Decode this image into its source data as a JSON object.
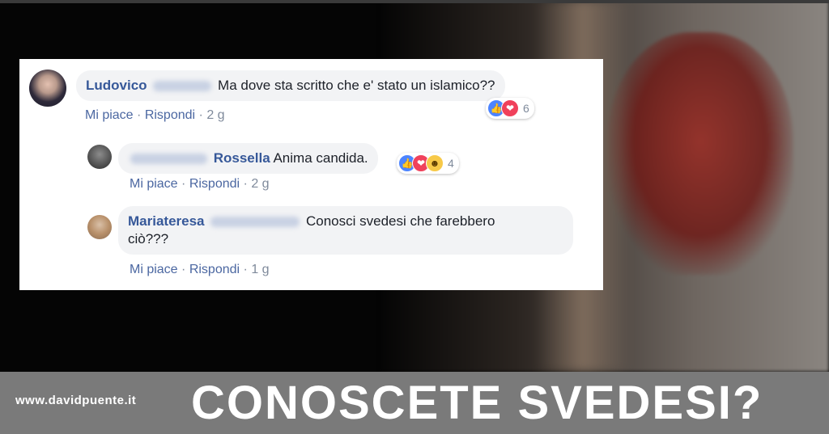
{
  "comments": [
    {
      "author": "Ludovico",
      "text": "Ma dove sta scritto che e' stato un islamico??",
      "actions": {
        "like": "Mi piace",
        "reply": "Rispondi",
        "time": "2 g"
      },
      "reactions": {
        "icons": [
          "like-icon",
          "love-icon"
        ],
        "count": "6"
      }
    },
    {
      "author": "Rossella",
      "text": "Anima candida.",
      "actions": {
        "like": "Mi piace",
        "reply": "Rispondi",
        "time": "2 g"
      },
      "reactions": {
        "icons": [
          "like-icon",
          "love-icon",
          "haha-icon"
        ],
        "count": "4"
      }
    },
    {
      "author": "Mariateresa",
      "text_line1": "Conosci svedesi che farebbero",
      "text_line2": "ciò???",
      "actions": {
        "like": "Mi piace",
        "reply": "Rispondi",
        "time": "1 g"
      }
    }
  ],
  "separator": "·",
  "banner": {
    "site": "www.davidpuente.it",
    "headline": "CONOSCETE SVEDESI?"
  },
  "colors": {
    "name": "#365899",
    "bubble": "#f2f3f5",
    "banner": "#7a7a7a",
    "like": "#4c84ff",
    "love": "#f0415b",
    "haha": "#f7c948"
  }
}
